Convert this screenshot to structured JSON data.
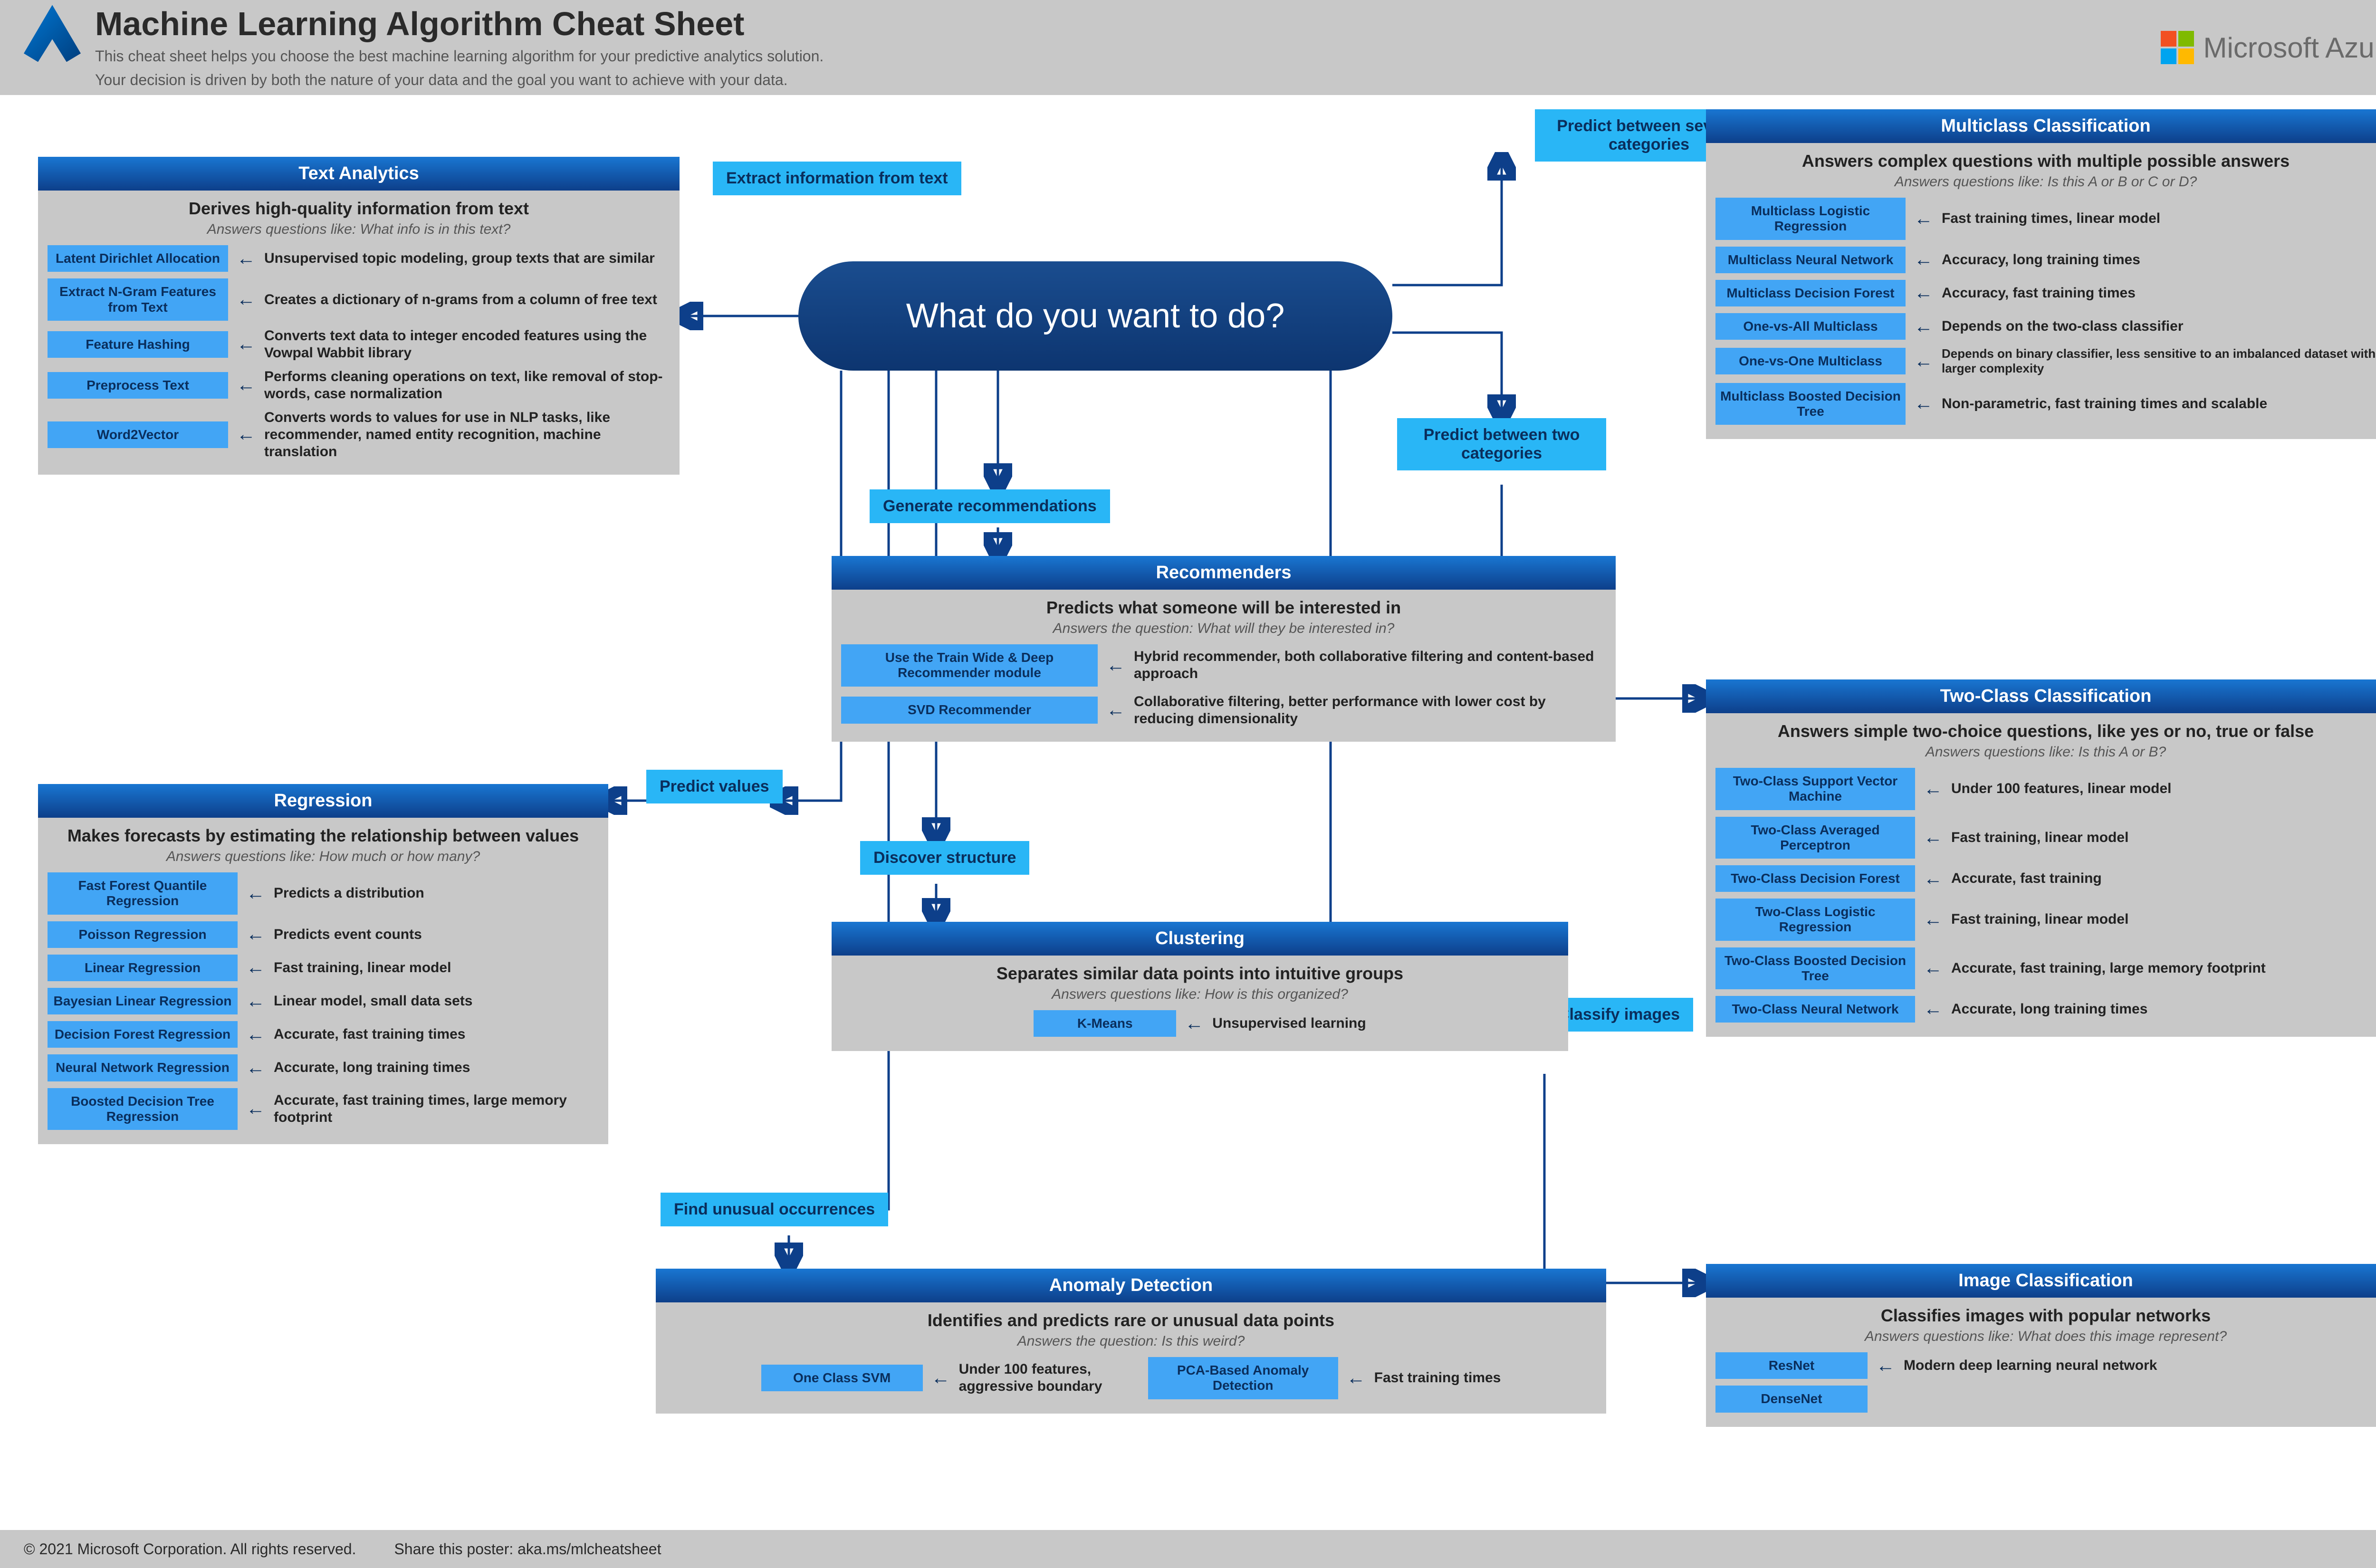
{
  "header": {
    "title": "Machine Learning Algorithm Cheat Sheet",
    "sub1": "This cheat sheet helps you choose the best machine learning algorithm for your predictive analytics solution.",
    "sub2": "Your decision is driven by both the nature of your data and the goal you want to achieve with your data.",
    "brand": "Microsoft Azure"
  },
  "center": "What do you want to do?",
  "branches": {
    "extract": "Extract information from text",
    "predval": "Predict values",
    "findun": "Find unusual occurrences",
    "discov": "Discover structure",
    "genrec": "Generate recommendations",
    "predmulti": "Predict between several categories",
    "predtwo": "Predict between two categories",
    "imgcls": "Classify images"
  },
  "text_analytics": {
    "title": "Text Analytics",
    "l1": "Derives high-quality information from text",
    "l2": "Answers questions like: What info is in this text?",
    "items": [
      {
        "a": "Latent Dirichlet Allocation",
        "d": "Unsupervised topic modeling, group texts that are similar"
      },
      {
        "a": "Extract N-Gram Features from Text",
        "d": "Creates a dictionary of n-grams from a column of free text"
      },
      {
        "a": "Feature Hashing",
        "d": "Converts text data to integer encoded features using the Vowpal Wabbit library"
      },
      {
        "a": "Preprocess Text",
        "d": "Performs cleaning operations on text, like removal of stop-words, case normalization"
      },
      {
        "a": "Word2Vector",
        "d": "Converts words to values for use in NLP tasks, like recommender, named entity recognition, machine translation"
      }
    ]
  },
  "regression": {
    "title": "Regression",
    "l1": "Makes forecasts by estimating the relationship between values",
    "l2": "Answers questions like: How much or how many?",
    "items": [
      {
        "a": "Fast Forest Quantile Regression",
        "d": "Predicts a distribution"
      },
      {
        "a": "Poisson Regression",
        "d": "Predicts event counts"
      },
      {
        "a": "Linear Regression",
        "d": "Fast training, linear model"
      },
      {
        "a": "Bayesian Linear Regression",
        "d": "Linear model, small data sets"
      },
      {
        "a": "Decision Forest Regression",
        "d": "Accurate, fast training times"
      },
      {
        "a": "Neural Network Regression",
        "d": "Accurate, long training times"
      },
      {
        "a": "Boosted Decision Tree Regression",
        "d": "Accurate, fast training times, large memory footprint"
      }
    ]
  },
  "recommenders": {
    "title": "Recommenders",
    "l1": "Predicts what someone will be interested in",
    "l2": "Answers the question: What will they be interested in?",
    "items": [
      {
        "a": "Use the Train Wide & Deep Recommender module",
        "d": "Hybrid recommender, both collaborative filtering and content-based approach"
      },
      {
        "a": "SVD Recommender",
        "d": "Collaborative filtering, better performance with lower cost by reducing dimensionality"
      }
    ]
  },
  "clustering": {
    "title": "Clustering",
    "l1": "Separates similar data points into intuitive groups",
    "l2": "Answers questions like: How is this organized?",
    "items": [
      {
        "a": "K-Means",
        "d": "Unsupervised learning"
      }
    ]
  },
  "anomaly": {
    "title": "Anomaly Detection",
    "l1": "Identifies and predicts rare or unusual data points",
    "l2": "Answers the question: Is this weird?",
    "items": [
      {
        "a": "One Class SVM",
        "d": "Under 100 features, aggressive boundary"
      },
      {
        "a": "PCA-Based Anomaly Detection",
        "d": "Fast training times"
      }
    ]
  },
  "multiclass": {
    "title": "Multiclass Classification",
    "l1": "Answers complex questions with multiple possible answers",
    "l2": "Answers questions like: Is this A or B or C or D?",
    "items": [
      {
        "a": "Multiclass Logistic Regression",
        "d": "Fast training times, linear model"
      },
      {
        "a": "Multiclass Neural Network",
        "d": "Accuracy, long training times"
      },
      {
        "a": "Multiclass Decision Forest",
        "d": "Accuracy, fast training times"
      },
      {
        "a": "One-vs-All Multiclass",
        "d": "Depends on the two-class classifier"
      },
      {
        "a": "One-vs-One Multiclass",
        "d": "Depends on binary classifier, less sensitive to an imbalanced dataset with larger complexity"
      },
      {
        "a": "Multiclass Boosted Decision Tree",
        "d": "Non-parametric, fast training times and scalable"
      }
    ]
  },
  "twoclass": {
    "title": "Two-Class Classification",
    "l1": "Answers simple two-choice questions, like yes or no, true or false",
    "l2": "Answers questions like: Is this A or B?",
    "items": [
      {
        "a": "Two-Class Support Vector Machine",
        "d": "Under 100 features, linear model"
      },
      {
        "a": "Two-Class Averaged Perceptron",
        "d": "Fast training, linear model"
      },
      {
        "a": "Two-Class Decision Forest",
        "d": "Accurate, fast training"
      },
      {
        "a": "Two-Class Logistic Regression",
        "d": "Fast training, linear model"
      },
      {
        "a": "Two-Class Boosted Decision Tree",
        "d": "Accurate, fast training, large memory footprint"
      },
      {
        "a": "Two-Class Neural Network",
        "d": "Accurate, long training times"
      }
    ]
  },
  "imgcls": {
    "title": "Image Classification",
    "l1": "Classifies images with popular networks",
    "l2": "Answers questions like: What does this image represent?",
    "items": [
      {
        "a": "ResNet",
        "d": "Modern deep learning neural network"
      },
      {
        "a": "DenseNet",
        "d": ""
      }
    ]
  },
  "footer": {
    "copy": "© 2021 Microsoft Corporation. All rights reserved.",
    "share": "Share this poster: aka.ms/mlcheatsheet"
  }
}
